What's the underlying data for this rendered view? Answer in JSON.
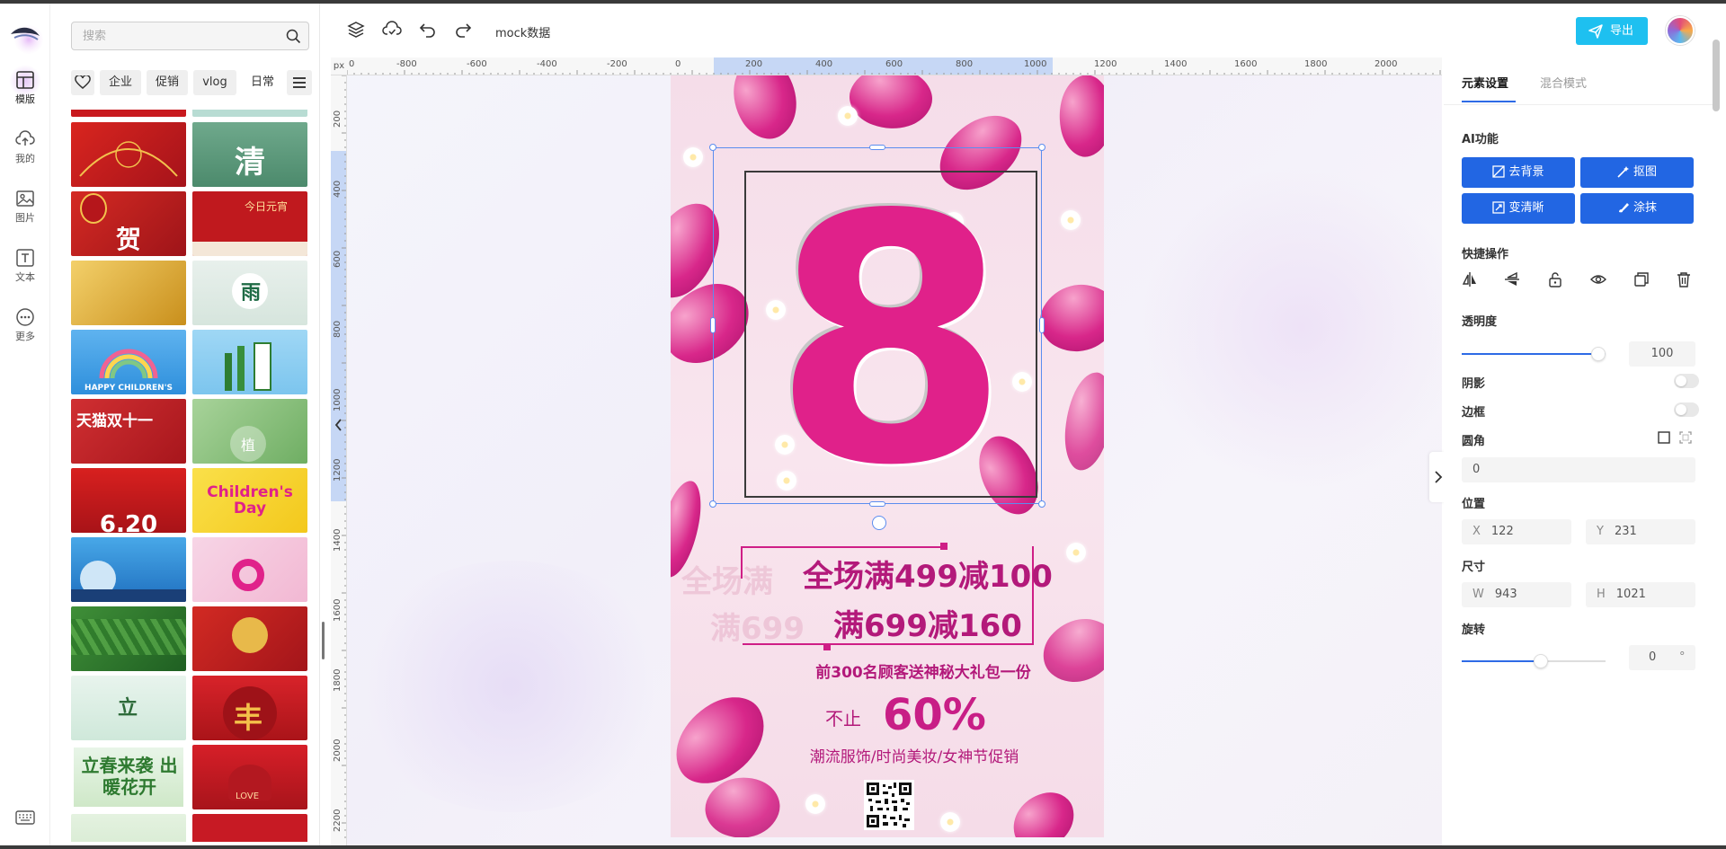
{
  "rail": {
    "items": [
      {
        "label": "模版",
        "icon": "template-icon"
      },
      {
        "label": "我的",
        "icon": "cloud-upload-icon"
      },
      {
        "label": "图片",
        "icon": "image-icon"
      },
      {
        "label": "文本",
        "icon": "text-icon"
      },
      {
        "label": "更多",
        "icon": "more-icon"
      }
    ]
  },
  "panel": {
    "search_placeholder": "搜索",
    "tags": [
      "企业",
      "促销",
      "vlog",
      "日常"
    ],
    "thumbs": [
      {
        "caption": "",
        "bg": "#c8191e"
      },
      {
        "caption": "清",
        "bg": "#5e9a7d"
      },
      {
        "caption": "贺",
        "bg": "#c01a1d"
      },
      {
        "caption": "今日元宵",
        "bg": "#b51b1f"
      },
      {
        "caption": "",
        "bg": "#e2b53a"
      },
      {
        "caption": "雨",
        "bg": "#dfe9e2"
      },
      {
        "caption": "HAPPY CHILDREN'S",
        "bg": "#4fa8e8"
      },
      {
        "caption": "",
        "bg": "#8fd0f2"
      },
      {
        "caption": "天猫双十一",
        "bg": "#c3242b"
      },
      {
        "caption": "植",
        "bg": "#8fc07f"
      },
      {
        "caption": "6.20",
        "bg": "#c2161a"
      },
      {
        "caption": "Children's Day",
        "bg": "#f2d21e"
      },
      {
        "caption": "",
        "bg": "#2a8fd6"
      },
      {
        "caption": "",
        "bg": "#e94b95"
      },
      {
        "caption": "",
        "bg": "#4f9a3e"
      },
      {
        "caption": "",
        "bg": "#c0191d"
      },
      {
        "caption": "立",
        "bg": "#dcefe6"
      },
      {
        "caption": "丰",
        "bg": "#c61a1f"
      },
      {
        "caption": "立春来袭 出暖花开",
        "bg": "#2f8a3c"
      },
      {
        "caption": "LOVE",
        "bg": "#c71a24"
      },
      {
        "caption": "",
        "bg": "#cfe6c9"
      },
      {
        "caption": "",
        "bg": "#c71a24"
      }
    ]
  },
  "toolbar": {
    "doc_title": "mock数据",
    "export_label": "导出"
  },
  "ruler": {
    "unit": "px",
    "top_labels": [
      "0",
      "-800",
      "-600",
      "-400",
      "-200",
      "0",
      "200",
      "400",
      "600",
      "800",
      "1000",
      "1200",
      "1400",
      "1600",
      "1800",
      "2000"
    ],
    "left_labels": [
      "200",
      "400",
      "600",
      "800",
      "1000",
      "1200",
      "1400",
      "1600",
      "1800",
      "2000",
      "2200"
    ]
  },
  "poster": {
    "big_number": "8",
    "offer1": "全场满499减100",
    "offer2": "满699减160",
    "ghost1": "全场满",
    "ghost2": "满699",
    "gift": "前300名顾客送神秘大礼包一份",
    "not_only": "不止",
    "percent": "60%",
    "categories": "潮流服饰/时尚美妆/女神节促销"
  },
  "rpanel": {
    "tab_active": "元素设置",
    "tab_inactive": "混合模式",
    "ai_title": "AI功能",
    "ai_buttons": [
      "去背景",
      "抠图",
      "变清晰",
      "涂抹"
    ],
    "quick_title": "快捷操作",
    "opacity_title": "透明度",
    "opacity_value": "100",
    "opacity_fraction": 1.0,
    "shadow_title": "阴影",
    "border_title": "边框",
    "radius_title": "圆角",
    "radius_value": "0",
    "position_title": "位置",
    "pos_x_label": "X",
    "pos_x": "122",
    "pos_y_label": "Y",
    "pos_y": "231",
    "size_title": "尺寸",
    "size_w_label": "W",
    "size_w": "943",
    "size_h_label": "H",
    "size_h": "1021",
    "rotate_title": "旋转",
    "rotate_value": "0",
    "rotate_unit": "°"
  },
  "colors": {
    "accent": "#2266e3",
    "export": "#1ec0f0",
    "poster_pink": "#c81e86"
  }
}
